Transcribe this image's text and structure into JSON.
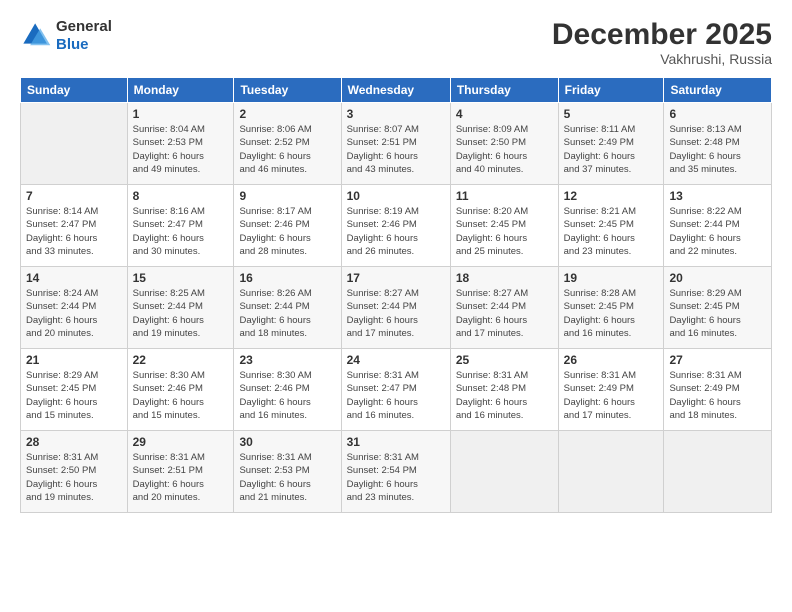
{
  "logo": {
    "general": "General",
    "blue": "Blue"
  },
  "header": {
    "month": "December 2025",
    "location": "Vakhrushi, Russia"
  },
  "weekdays": [
    "Sunday",
    "Monday",
    "Tuesday",
    "Wednesday",
    "Thursday",
    "Friday",
    "Saturday"
  ],
  "weeks": [
    [
      {
        "day": "",
        "detail": ""
      },
      {
        "day": "1",
        "detail": "Sunrise: 8:04 AM\nSunset: 2:53 PM\nDaylight: 6 hours\nand 49 minutes."
      },
      {
        "day": "2",
        "detail": "Sunrise: 8:06 AM\nSunset: 2:52 PM\nDaylight: 6 hours\nand 46 minutes."
      },
      {
        "day": "3",
        "detail": "Sunrise: 8:07 AM\nSunset: 2:51 PM\nDaylight: 6 hours\nand 43 minutes."
      },
      {
        "day": "4",
        "detail": "Sunrise: 8:09 AM\nSunset: 2:50 PM\nDaylight: 6 hours\nand 40 minutes."
      },
      {
        "day": "5",
        "detail": "Sunrise: 8:11 AM\nSunset: 2:49 PM\nDaylight: 6 hours\nand 37 minutes."
      },
      {
        "day": "6",
        "detail": "Sunrise: 8:13 AM\nSunset: 2:48 PM\nDaylight: 6 hours\nand 35 minutes."
      }
    ],
    [
      {
        "day": "7",
        "detail": "Sunrise: 8:14 AM\nSunset: 2:47 PM\nDaylight: 6 hours\nand 33 minutes."
      },
      {
        "day": "8",
        "detail": "Sunrise: 8:16 AM\nSunset: 2:47 PM\nDaylight: 6 hours\nand 30 minutes."
      },
      {
        "day": "9",
        "detail": "Sunrise: 8:17 AM\nSunset: 2:46 PM\nDaylight: 6 hours\nand 28 minutes."
      },
      {
        "day": "10",
        "detail": "Sunrise: 8:19 AM\nSunset: 2:46 PM\nDaylight: 6 hours\nand 26 minutes."
      },
      {
        "day": "11",
        "detail": "Sunrise: 8:20 AM\nSunset: 2:45 PM\nDaylight: 6 hours\nand 25 minutes."
      },
      {
        "day": "12",
        "detail": "Sunrise: 8:21 AM\nSunset: 2:45 PM\nDaylight: 6 hours\nand 23 minutes."
      },
      {
        "day": "13",
        "detail": "Sunrise: 8:22 AM\nSunset: 2:44 PM\nDaylight: 6 hours\nand 22 minutes."
      }
    ],
    [
      {
        "day": "14",
        "detail": "Sunrise: 8:24 AM\nSunset: 2:44 PM\nDaylight: 6 hours\nand 20 minutes."
      },
      {
        "day": "15",
        "detail": "Sunrise: 8:25 AM\nSunset: 2:44 PM\nDaylight: 6 hours\nand 19 minutes."
      },
      {
        "day": "16",
        "detail": "Sunrise: 8:26 AM\nSunset: 2:44 PM\nDaylight: 6 hours\nand 18 minutes."
      },
      {
        "day": "17",
        "detail": "Sunrise: 8:27 AM\nSunset: 2:44 PM\nDaylight: 6 hours\nand 17 minutes."
      },
      {
        "day": "18",
        "detail": "Sunrise: 8:27 AM\nSunset: 2:44 PM\nDaylight: 6 hours\nand 17 minutes."
      },
      {
        "day": "19",
        "detail": "Sunrise: 8:28 AM\nSunset: 2:45 PM\nDaylight: 6 hours\nand 16 minutes."
      },
      {
        "day": "20",
        "detail": "Sunrise: 8:29 AM\nSunset: 2:45 PM\nDaylight: 6 hours\nand 16 minutes."
      }
    ],
    [
      {
        "day": "21",
        "detail": "Sunrise: 8:29 AM\nSunset: 2:45 PM\nDaylight: 6 hours\nand 15 minutes."
      },
      {
        "day": "22",
        "detail": "Sunrise: 8:30 AM\nSunset: 2:46 PM\nDaylight: 6 hours\nand 15 minutes."
      },
      {
        "day": "23",
        "detail": "Sunrise: 8:30 AM\nSunset: 2:46 PM\nDaylight: 6 hours\nand 16 minutes."
      },
      {
        "day": "24",
        "detail": "Sunrise: 8:31 AM\nSunset: 2:47 PM\nDaylight: 6 hours\nand 16 minutes."
      },
      {
        "day": "25",
        "detail": "Sunrise: 8:31 AM\nSunset: 2:48 PM\nDaylight: 6 hours\nand 16 minutes."
      },
      {
        "day": "26",
        "detail": "Sunrise: 8:31 AM\nSunset: 2:49 PM\nDaylight: 6 hours\nand 17 minutes."
      },
      {
        "day": "27",
        "detail": "Sunrise: 8:31 AM\nSunset: 2:49 PM\nDaylight: 6 hours\nand 18 minutes."
      }
    ],
    [
      {
        "day": "28",
        "detail": "Sunrise: 8:31 AM\nSunset: 2:50 PM\nDaylight: 6 hours\nand 19 minutes."
      },
      {
        "day": "29",
        "detail": "Sunrise: 8:31 AM\nSunset: 2:51 PM\nDaylight: 6 hours\nand 20 minutes."
      },
      {
        "day": "30",
        "detail": "Sunrise: 8:31 AM\nSunset: 2:53 PM\nDaylight: 6 hours\nand 21 minutes."
      },
      {
        "day": "31",
        "detail": "Sunrise: 8:31 AM\nSunset: 2:54 PM\nDaylight: 6 hours\nand 23 minutes."
      },
      {
        "day": "",
        "detail": ""
      },
      {
        "day": "",
        "detail": ""
      },
      {
        "day": "",
        "detail": ""
      }
    ]
  ]
}
